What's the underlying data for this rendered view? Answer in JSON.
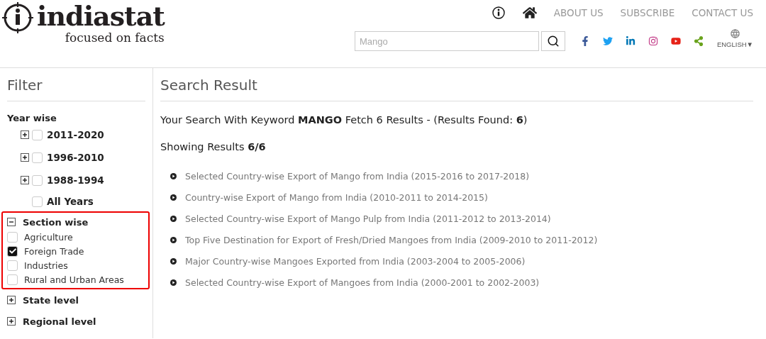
{
  "logo": {
    "name": "indiastat",
    "tagline": "focused on facts"
  },
  "nav": {
    "links": [
      "ABOUT US",
      "SUBSCRIBE",
      "CONTACT US"
    ]
  },
  "search": {
    "placeholder": "Mango"
  },
  "language": {
    "label": "ENGLISH▼"
  },
  "filter": {
    "title": "Filter",
    "year_wise": {
      "label": "Year wise",
      "items": [
        {
          "label": "2011-2020",
          "expandable": true,
          "checked": false
        },
        {
          "label": "1996-2010",
          "expandable": true,
          "checked": false
        },
        {
          "label": "1988-1994",
          "expandable": true,
          "checked": false
        },
        {
          "label": "All Years",
          "expandable": false,
          "checked": false
        }
      ]
    },
    "sections": [
      {
        "label": "Section wise",
        "expanded": true,
        "highlighted": true,
        "items": [
          {
            "label": "Agriculture",
            "checked": false
          },
          {
            "label": "Foreign Trade",
            "checked": true
          },
          {
            "label": "Industries",
            "checked": false
          },
          {
            "label": "Rural and Urban Areas",
            "checked": false
          }
        ]
      },
      {
        "label": "State level",
        "expanded": false,
        "highlighted": false
      },
      {
        "label": "Regional level",
        "expanded": false,
        "highlighted": false
      }
    ]
  },
  "results": {
    "title": "Search Result",
    "summary": "Your Search With Keyword **MANGO** Fetch 6 Results - (Results Found: **6**)",
    "showing": "Showing Results **6/6**",
    "items": [
      "Selected Country-wise Export of Mango from India (2015-2016 to 2017-2018)",
      "Country-wise Export of Mango from India (2010-2011 to 2014-2015)",
      "Selected Country-wise Export of Mango Pulp from India (2011-2012 to 2013-2014)",
      "Top Five Destination for Export of Fresh/Dried Mangoes from India (2009-2010 to 2011-2012)",
      "Major Country-wise Mangoes Exported from India (2003-2004 to 2005-2006)",
      "Selected Country-wise Export of Mangoes from India (2000-2001 to 2002-2003)"
    ]
  }
}
